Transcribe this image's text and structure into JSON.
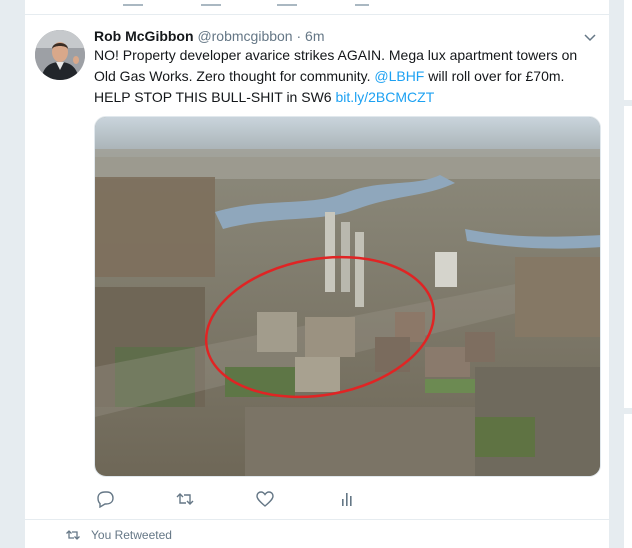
{
  "tweet": {
    "author_name": "Rob McGibbon",
    "handle": "@robmcgibbon",
    "separator": "·",
    "time": "6m",
    "text_parts": {
      "line1": "NO! Property developer avarice strikes AGAIN. Mega lux apartment towers on Old Gas Works. Zero thought for community. ",
      "mention": "@LBHF",
      "line2": " will roll over for £70m. HELP STOP THIS BULL-SHIT in SW6 ",
      "link": "bit.ly/2BCMCZT"
    },
    "media": {
      "description_icon": "aerial-photo",
      "highlight_color": "#e02424"
    }
  },
  "actions": {
    "reply_icon": "reply-icon",
    "retweet_icon": "retweet-icon",
    "like_icon": "heart-icon",
    "analytics_icon": "analytics-icon"
  },
  "footer": {
    "retweeted_label": "You Retweeted"
  },
  "colors": {
    "link": "#1da1f2",
    "text": "#14171a",
    "muted": "#657786",
    "background": "#e6ecf0"
  }
}
